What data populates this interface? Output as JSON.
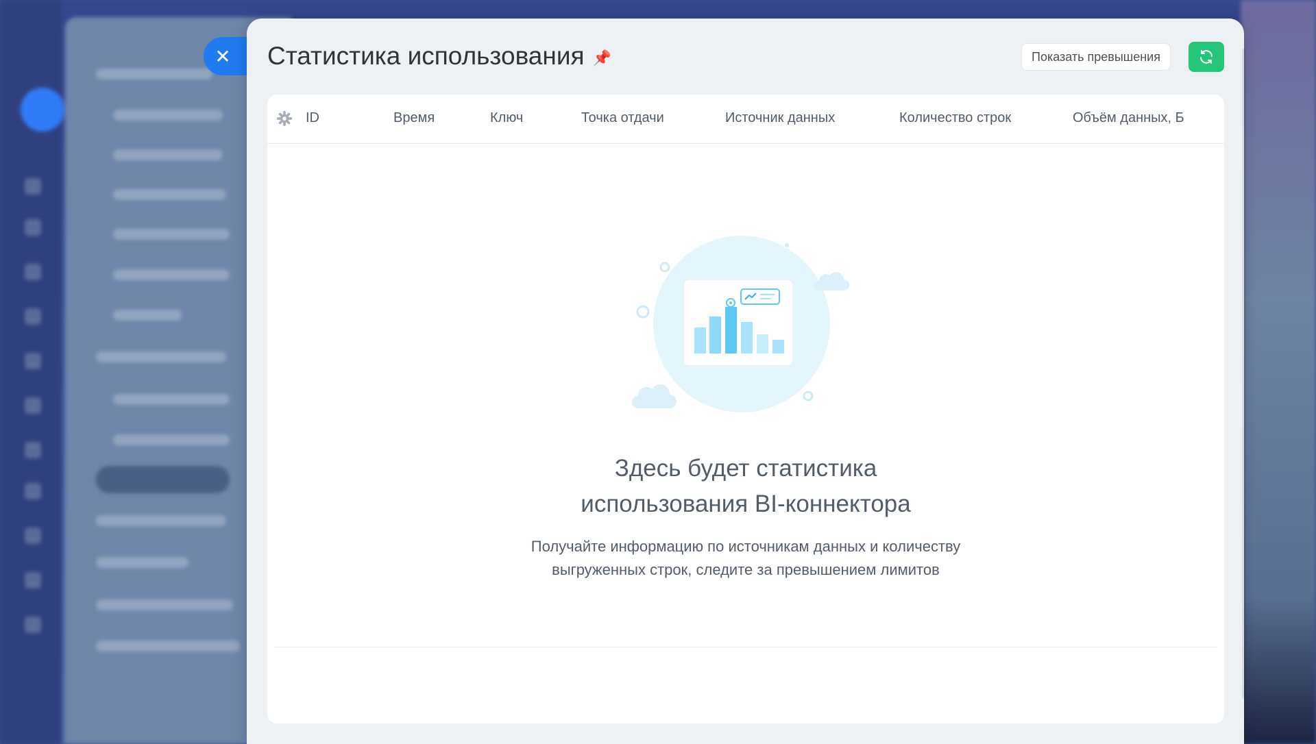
{
  "slider": {
    "title": "Статистика использования",
    "show_excess_label": "Показать превышения"
  },
  "table": {
    "columns": [
      "ID",
      "Время",
      "Ключ",
      "Точка отдачи",
      "Источник данных",
      "Количество строк",
      "Объём данных, Б"
    ]
  },
  "empty_state": {
    "title_lines": [
      "Здесь будет статистика",
      "использования BI-коннектора"
    ],
    "desc_lines": [
      "Получайте информацию по источникам данных и количеству",
      "выгруженных строк, следите за превышением лимитов"
    ]
  },
  "icons": {
    "close": "close-icon",
    "pin": "pin-icon",
    "refresh": "refresh-icon",
    "settings": "gear-icon"
  },
  "colors": {
    "accent_blue": "#1f7bef",
    "refresh_green": "#24c77a",
    "panel_bg": "#edf1f4"
  }
}
